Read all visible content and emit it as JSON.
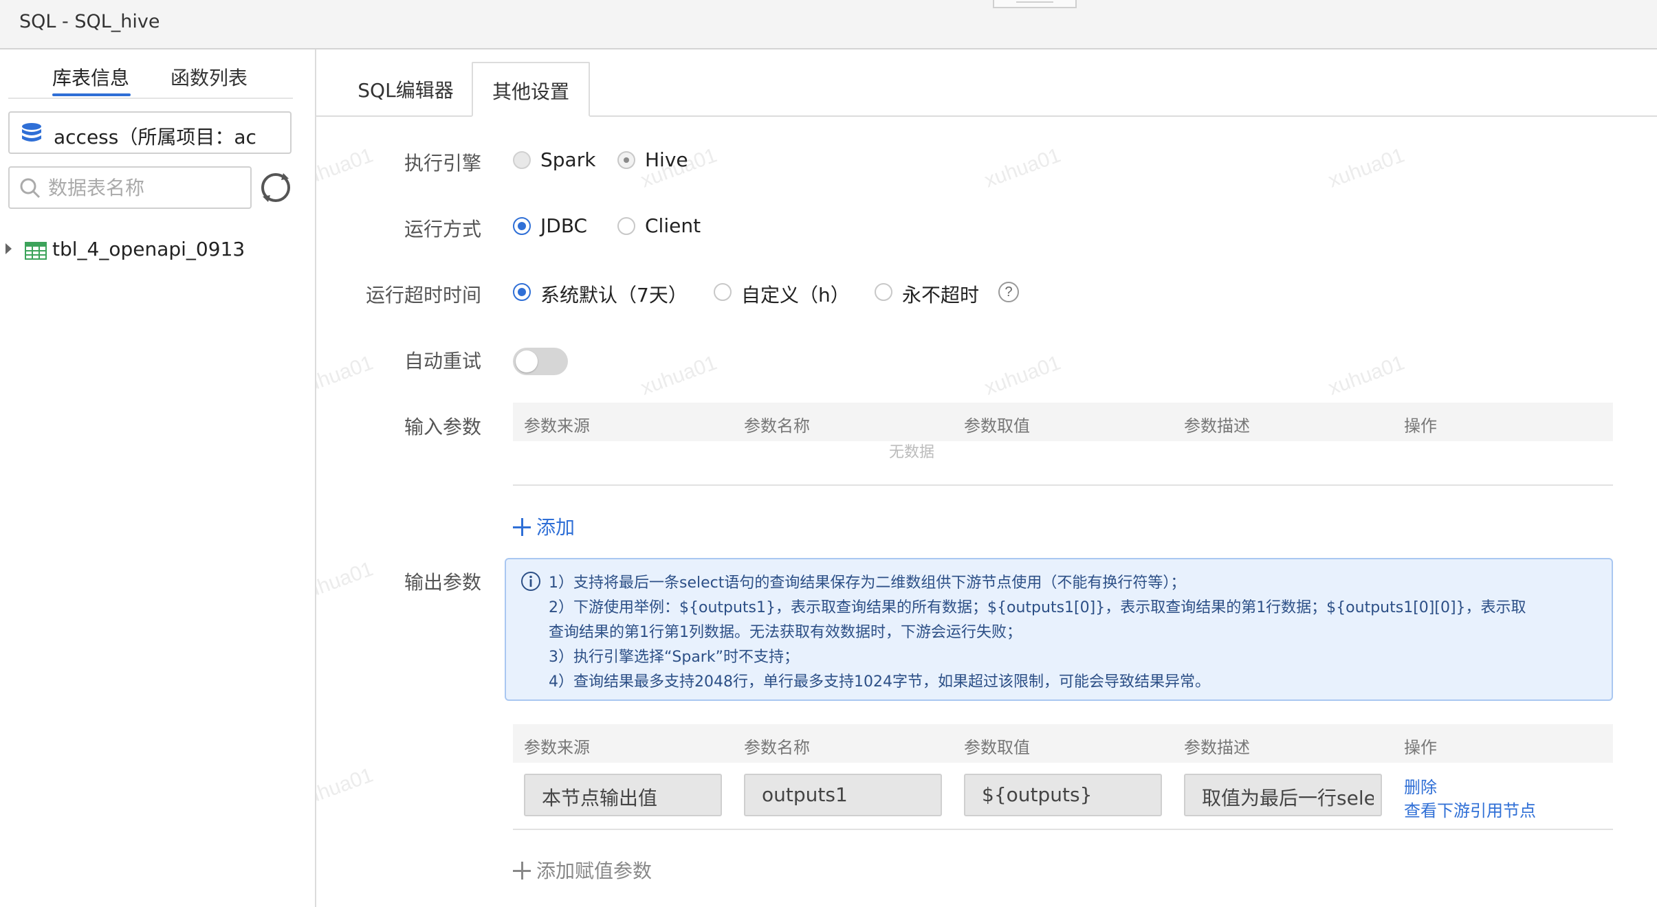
{
  "window": {
    "title": "SQL - SQL_hive"
  },
  "sidebar": {
    "tabs": [
      {
        "label": "库表信息",
        "active": true
      },
      {
        "label": "函数列表",
        "active": false
      }
    ],
    "database": {
      "label": "access（所属项目：ac",
      "icon": "database-icon"
    },
    "search": {
      "placeholder": "数据表名称",
      "value": ""
    },
    "tables": [
      {
        "name": "tbl_4_openapi_0913",
        "icon": "table-icon"
      }
    ]
  },
  "main": {
    "tabs": [
      {
        "label": "SQL编辑器",
        "active": false
      },
      {
        "label": "其他设置",
        "active": true
      }
    ],
    "engine": {
      "label": "执行引擎",
      "options": [
        {
          "label": "Spark",
          "selected": false,
          "disabled": true
        },
        {
          "label": "Hive",
          "selected": true,
          "disabled": true
        }
      ]
    },
    "run_mode": {
      "label": "运行方式",
      "options": [
        {
          "label": "JDBC",
          "selected": true
        },
        {
          "label": "Client",
          "selected": false
        }
      ]
    },
    "timeout": {
      "label": "运行超时时间",
      "options": [
        {
          "label": "系统默认（7天）",
          "selected": true
        },
        {
          "label": "自定义（h）",
          "selected": false
        },
        {
          "label": "永不超时",
          "selected": false
        }
      ],
      "help": "?"
    },
    "auto_retry": {
      "label": "自动重试",
      "enabled": false
    },
    "input_params": {
      "label": "输入参数",
      "columns": [
        "参数来源",
        "参数名称",
        "参数取值",
        "参数描述",
        "操作"
      ],
      "empty_text": "无数据",
      "add_label": "添加"
    },
    "output_params": {
      "label": "输出参数",
      "notice_lines": [
        "1）支持将最后一条select语句的查询结果保存为二维数组供下游节点使用（不能有换行符等）；",
        "2）下游使用举例：${outputs1}，表示取查询结果的所有数据；${outputs1[0]}，表示取查询结果的第1行数据；${outputs1[0][0]}，表示取",
        "查询结果的第1行第1列数据。无法获取有效数据时，下游会运行失败；",
        "3）执行引擎选择“Spark”时不支持；",
        "4）查询结果最多支持2048行，单行最多支持1024字节，如果超过该限制，可能会导致结果异常。"
      ],
      "columns": [
        "参数来源",
        "参数名称",
        "参数取值",
        "参数描述",
        "操作"
      ],
      "rows": [
        {
          "source": "本节点输出值",
          "name": "outputs1",
          "value": "${outputs}",
          "description": "取值为最后一行sele",
          "actions": [
            "删除",
            "查看下游引用节点"
          ]
        }
      ],
      "add_label": "添加赋值参数"
    }
  },
  "watermark": "xuhua01",
  "colors": {
    "accent": "#2f6fd6",
    "notice_bg": "#e8f1fd",
    "notice_text": "#2c4f86"
  }
}
